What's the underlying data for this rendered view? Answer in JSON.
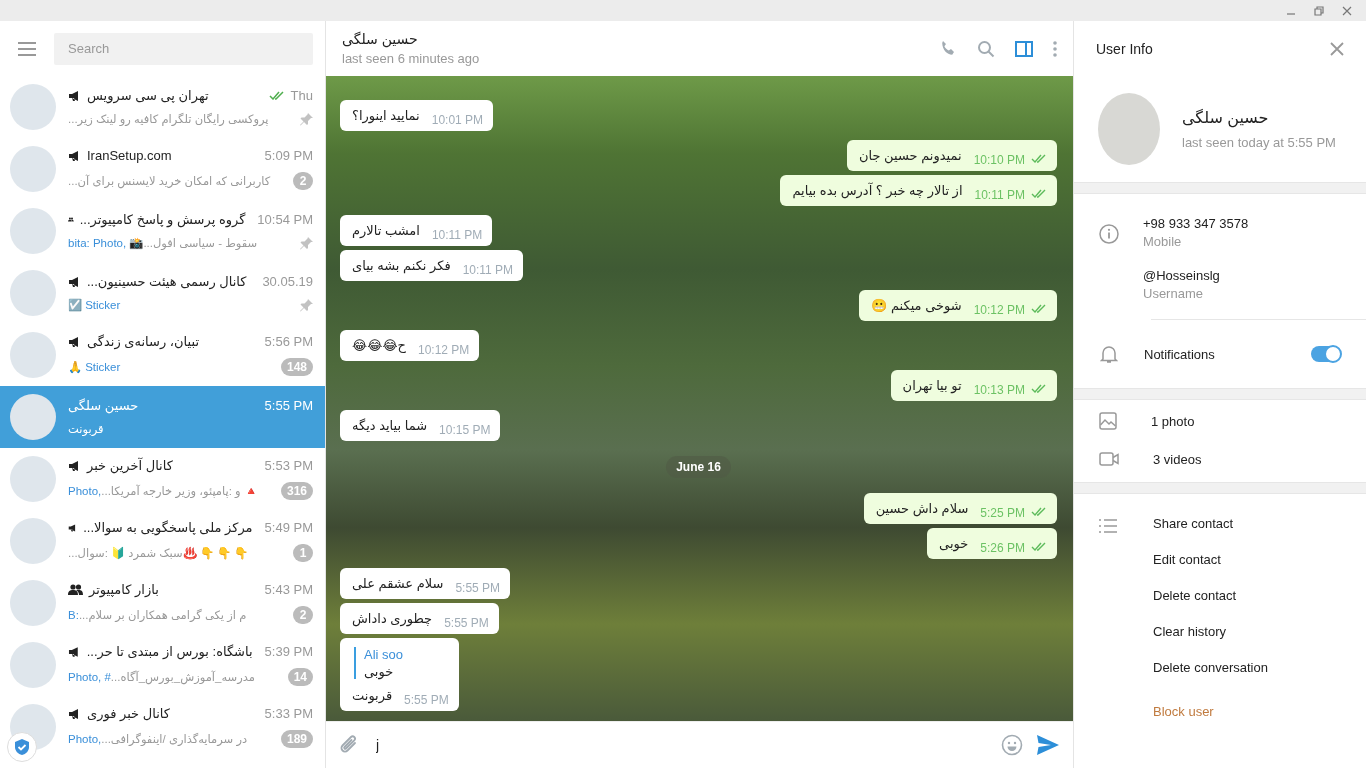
{
  "sidebar": {
    "search": {
      "placeholder": "Search"
    },
    "chats": [
      {
        "name": "تهران پی سی سرویس",
        "kind": "channel",
        "time": "Thu",
        "read": true,
        "preview": "پروکسی رایگان تلگرام  کافیه رو لینک زیر...",
        "pinned": true,
        "selected": false
      },
      {
        "name": "IranSetup.com",
        "kind": "channel",
        "time": "5:09 PM",
        "read": false,
        "preview": "کاربرانی که امکان خرید لایسنس برای آن...",
        "badge": "2",
        "pinned": false,
        "selected": false
      },
      {
        "name": "گروه پرسش و پاسخ کامپیوتر...",
        "kind": "group",
        "time": "10:54 PM",
        "read": false,
        "preview_prefix": "bita: Photo, 📸",
        "preview": "سقوط - سیاسی افول...",
        "pinned": true,
        "selected": false
      },
      {
        "name": "کانال رسمی هیئت حسینیون...",
        "kind": "channel",
        "time": "30.05.19",
        "read": false,
        "preview_prefix": "☑️ Sticker",
        "pinned": true,
        "selected": false
      },
      {
        "name": "تبیان، رسانه‌ی زندگی",
        "kind": "channel",
        "time": "5:56 PM",
        "read": false,
        "preview_prefix": "🙏 Sticker",
        "badge": "148",
        "pinned": false,
        "selected": false
      },
      {
        "name": "حسین سلگی",
        "kind": "user",
        "time": "5:55 PM",
        "read": false,
        "preview": "قربونت",
        "pinned": false,
        "selected": true
      },
      {
        "name": "کانال آخرین خبر",
        "kind": "channel",
        "time": "5:53 PM",
        "read": false,
        "preview_prefix": "Photo,",
        "preview": "🔺 و :پامپئو، وزیر خارجه آمریکا...",
        "badge": "316",
        "pinned": false,
        "selected": false
      },
      {
        "name": "مرکز ملی پاسخگویی به سوالا...",
        "kind": "channel",
        "time": "5:49 PM",
        "read": false,
        "preview": "👇 👇 👇 ♨️سبک شمرد 🔰 :سوال...",
        "badge": "1",
        "pinned": false,
        "selected": false
      },
      {
        "name": "بازار کامپیوتر",
        "kind": "group",
        "time": "5:43 PM",
        "read": false,
        "preview_prefix": "B:",
        "preview": "م از یکی   گرامی همکاران بر سلام...",
        "badge": "2",
        "pinned": false,
        "selected": false
      },
      {
        "name": "باشگاه: بورس از مبتدی تا حر...",
        "kind": "channel",
        "time": "5:39 PM",
        "read": false,
        "preview_prefix": "Photo, #",
        "preview": "مدرسه_آموزش_بورس_آگاه...",
        "badge": "14",
        "pinned": false,
        "selected": false
      },
      {
        "name": "کانال خبر فوری",
        "kind": "channel",
        "time": "5:33 PM",
        "read": false,
        "preview_prefix": "Photo,",
        "preview": "در سرمایه‌گذاری /اینفوگرافی...",
        "badge": "189",
        "pinned": false,
        "selected": false
      }
    ]
  },
  "chat": {
    "title": "حسین سلگی",
    "status": "last seen 6 minutes ago",
    "header_buttons": [
      {
        "kind": "call",
        "selected": false
      },
      {
        "kind": "search",
        "selected": false
      },
      {
        "kind": "panel",
        "selected": true
      },
      {
        "kind": "more",
        "selected": false
      }
    ],
    "messages": [
      {
        "kind": "incoming",
        "text": "نمایید اینورا؟",
        "time": "10:01 PM"
      },
      {
        "kind": "outgoing",
        "text": "نمیدونم حسین جان",
        "time": "10:10 PM",
        "read": true
      },
      {
        "kind": "outgoing",
        "text": "از تالار چه خبر ؟ آدرس بده بیایم",
        "time": "10:11 PM",
        "read": true
      },
      {
        "kind": "incoming",
        "text": "امشب تالارم",
        "time": "10:11 PM"
      },
      {
        "kind": "incoming",
        "text": "فکر نکنم بشه بیای",
        "time": "10:11 PM"
      },
      {
        "kind": "outgoing",
        "text": "شوخی میکنم 😬",
        "time": "10:12 PM",
        "read": true
      },
      {
        "kind": "incoming",
        "text": "ح😂😂😂",
        "time": "10:12 PM"
      },
      {
        "kind": "outgoing",
        "text": "تو بیا تهران",
        "time": "10:13 PM",
        "read": true
      },
      {
        "kind": "incoming",
        "text": "شما بیاید دیگه",
        "time": "10:15 PM"
      },
      {
        "kind": "date",
        "text": "June 16"
      },
      {
        "kind": "outgoing",
        "text": "سلام داش حسین",
        "time": "5:25 PM",
        "read": true
      },
      {
        "kind": "outgoing",
        "text": "خوبی",
        "time": "5:26 PM",
        "read": true
      },
      {
        "kind": "incoming",
        "text": "سلام عشقم علی",
        "time": "5:55 PM"
      },
      {
        "kind": "incoming",
        "text": "چطوری داداش",
        "time": "5:55 PM"
      },
      {
        "kind": "incoming",
        "text": "قربونت",
        "time": "5:55 PM",
        "reply": {
          "author": "Ali soo",
          "text": "خوبی"
        }
      }
    ],
    "composer": {
      "value": "j"
    }
  },
  "user_info": {
    "title": "User Info",
    "name": "حسین سلگی",
    "status": "last seen today at 5:55 PM",
    "phone": "+98 933 347 3578",
    "phone_label": "Mobile",
    "username": "@Hosseinslg",
    "username_label": "Username",
    "notifications": {
      "label": "Notifications",
      "on": true
    },
    "media": [
      {
        "kind": "photo",
        "label": "1 photo"
      },
      {
        "kind": "video",
        "label": "3 videos"
      }
    ],
    "actions": [
      {
        "label": "Share contact",
        "kind": "normal"
      },
      {
        "label": "Edit contact",
        "kind": "normal"
      },
      {
        "label": "Delete contact",
        "kind": "normal"
      },
      {
        "label": "Clear history",
        "kind": "normal"
      },
      {
        "label": "Delete conversation",
        "kind": "normal"
      },
      {
        "label": "Block user",
        "kind": "danger"
      }
    ]
  }
}
